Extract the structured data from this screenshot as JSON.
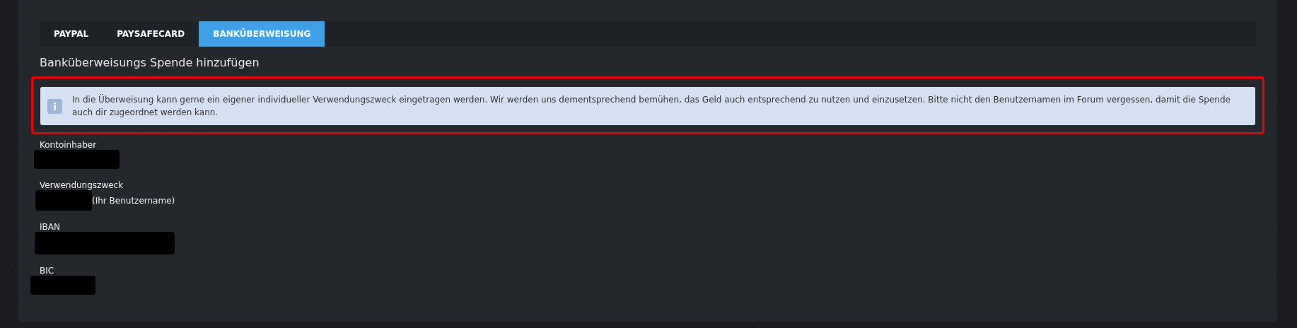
{
  "tabs": [
    {
      "label": "PAYPAL",
      "selected": false
    },
    {
      "label": "PAYSAFECARD",
      "selected": false
    },
    {
      "label": "BANKÜBERWEISUNG",
      "selected": true
    }
  ],
  "heading": "Banküberweisungs Spende hinzufügen",
  "notice": {
    "highlighted": true,
    "text": "In die Überweisung kann gerne ein eigener individueller Verwendungszweck eingetragen werden. Wir werden uns dementsprechend bemühen, das Geld auch entsprechend zu nutzen und einzusetzen. Bitte nicht den Benutzernamen im Forum vergessen, damit die Spende auch dir zugeordnet werden kann."
  },
  "fields": [
    {
      "label": "Kontoinhaber",
      "redacted": true
    },
    {
      "label": "Verwendungszweck",
      "redacted": true,
      "note": "(Ihr Benutzername)"
    },
    {
      "label": "IBAN",
      "redacted": true
    },
    {
      "label": "BIC",
      "redacted": true
    }
  ]
}
